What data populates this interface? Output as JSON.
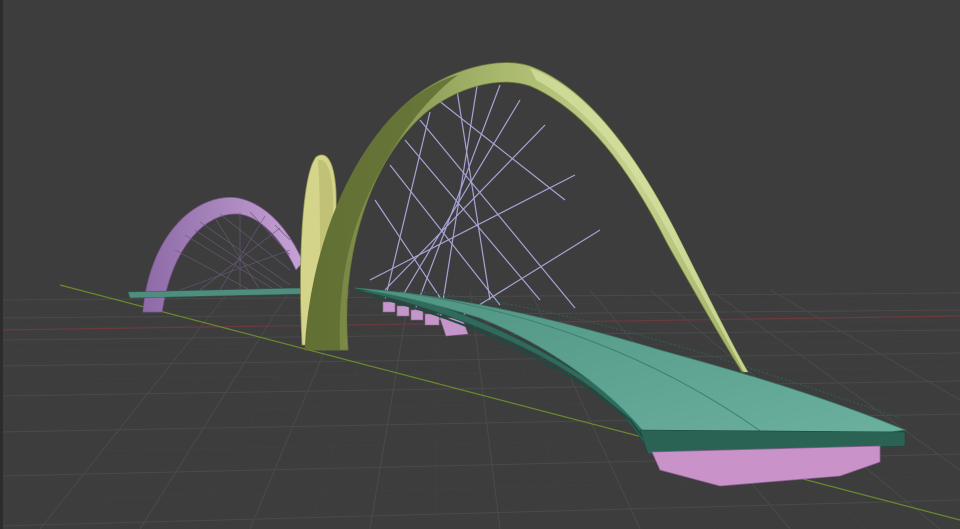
{
  "app": {
    "view": "3D viewport",
    "shading": "solid",
    "object_names": [
      "arch-main",
      "arch-secondary",
      "arch-far",
      "deck",
      "pier",
      "hangers",
      "railing"
    ]
  },
  "colors": {
    "background": "#3d3d3d",
    "grid_minor": "#444444",
    "grid_major": "#4b4b4b",
    "axis_x": "#7a3f44",
    "axis_y": "#6e8a2f",
    "arch_main_light": "#c4d08c",
    "arch_main_dark": "#7b8a45",
    "arch_secondary": "#d3d48b",
    "arch_far": "#b58fc9",
    "deck_top": "#5ea493",
    "deck_side": "#2f6a5c",
    "pier": "#c894c9",
    "hangers": "#a5a2d2"
  }
}
